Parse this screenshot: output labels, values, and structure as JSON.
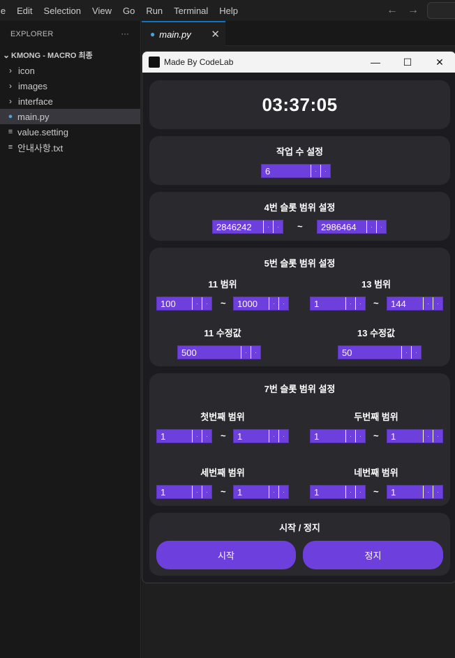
{
  "menubar": {
    "items": [
      "le",
      "Edit",
      "Selection",
      "View",
      "Go",
      "Run",
      "Terminal",
      "Help"
    ]
  },
  "explorer": {
    "header": "EXPLORER",
    "more": "···",
    "root": "KMONG - MACRO 최종",
    "items": [
      {
        "label": "icon",
        "kind": "folder"
      },
      {
        "label": "images",
        "kind": "folder"
      },
      {
        "label": "interface",
        "kind": "folder"
      },
      {
        "label": "main.py",
        "kind": "python"
      },
      {
        "label": "value.setting",
        "kind": "file"
      },
      {
        "label": "안내사항.txt",
        "kind": "file"
      }
    ]
  },
  "editor": {
    "tab_label": "main.py"
  },
  "app": {
    "title": "Made By CodeLab",
    "clock": "03:37:05",
    "work_count": {
      "title": "작업 수 설정",
      "value": "6"
    },
    "slot4": {
      "title": "4번 슬롯 범위 설정",
      "from": "2846242",
      "to": "2986464"
    },
    "slot5": {
      "title": "5번 슬롯 범위 설정",
      "range11_label": "11 범위",
      "range11_from": "100",
      "range11_to": "1000",
      "range13_label": "13 범위",
      "range13_from": "1",
      "range13_to": "144",
      "fix11_label": "11 수정값",
      "fix11_value": "500",
      "fix13_label": "13 수정값",
      "fix13_value": "50"
    },
    "slot7": {
      "title": "7번 슬롯 범위 설정",
      "r1_label": "첫번째 범위",
      "r1_from": "1",
      "r1_to": "1",
      "r2_label": "두번째 범위",
      "r2_from": "1",
      "r2_to": "1",
      "r3_label": "세번째 범위",
      "r3_from": "1",
      "r3_to": "1",
      "r4_label": "네번째 범위",
      "r4_from": "1",
      "r4_to": "1"
    },
    "control": {
      "title": "시작 / 정지",
      "start": "시작",
      "stop": "정지"
    },
    "tilde": "~"
  },
  "colors": {
    "accent": "#6d3fdc",
    "panel": "#2a292e",
    "window_bg": "#1c1b1f"
  }
}
